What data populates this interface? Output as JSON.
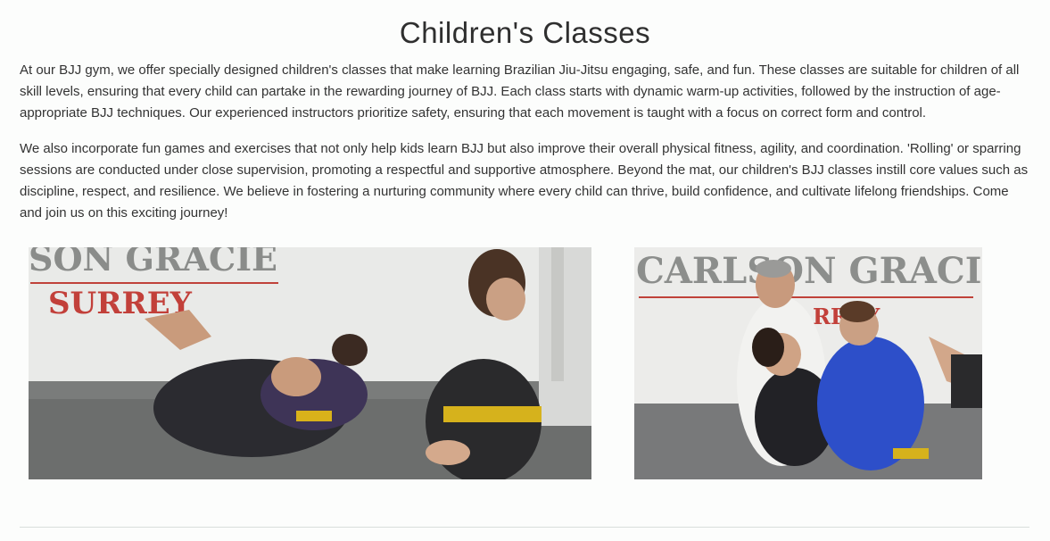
{
  "section": {
    "title": "Children's Classes",
    "paragraphs": [
      "At our BJJ gym, we offer specially designed children's classes that make learning Brazilian Jiu-Jitsu engaging, safe, and fun. These classes are suitable for children of all skill levels, ensuring that every child can partake in the rewarding journey of BJJ. Each class starts with dynamic warm-up activities, followed by the instruction of age-appropriate BJJ techniques. Our experienced instructors prioritize safety, ensuring that each movement is taught with a focus on correct form and control.",
      "We also incorporate fun games and exercises that not only help kids learn BJJ but also improve their overall physical fitness, agility, and coordination. 'Rolling' or sparring sessions are conducted under close supervision, promoting a respectful and supportive atmosphere. Beyond the mat, our children's BJJ classes instill core values such as discipline, respect, and resilience. We believe in fostering a nurturing community where every child can thrive, build confidence, and cultivate lifelong friendships. Come and join us on this exciting journey!"
    ]
  },
  "photos": {
    "photo1": {
      "wall_text_top": "SON GRACIE",
      "wall_text_bottom": "SURREY"
    },
    "photo2": {
      "wall_text_top": "CARLSON GRACIE",
      "wall_text_bottom": "RREY"
    }
  }
}
